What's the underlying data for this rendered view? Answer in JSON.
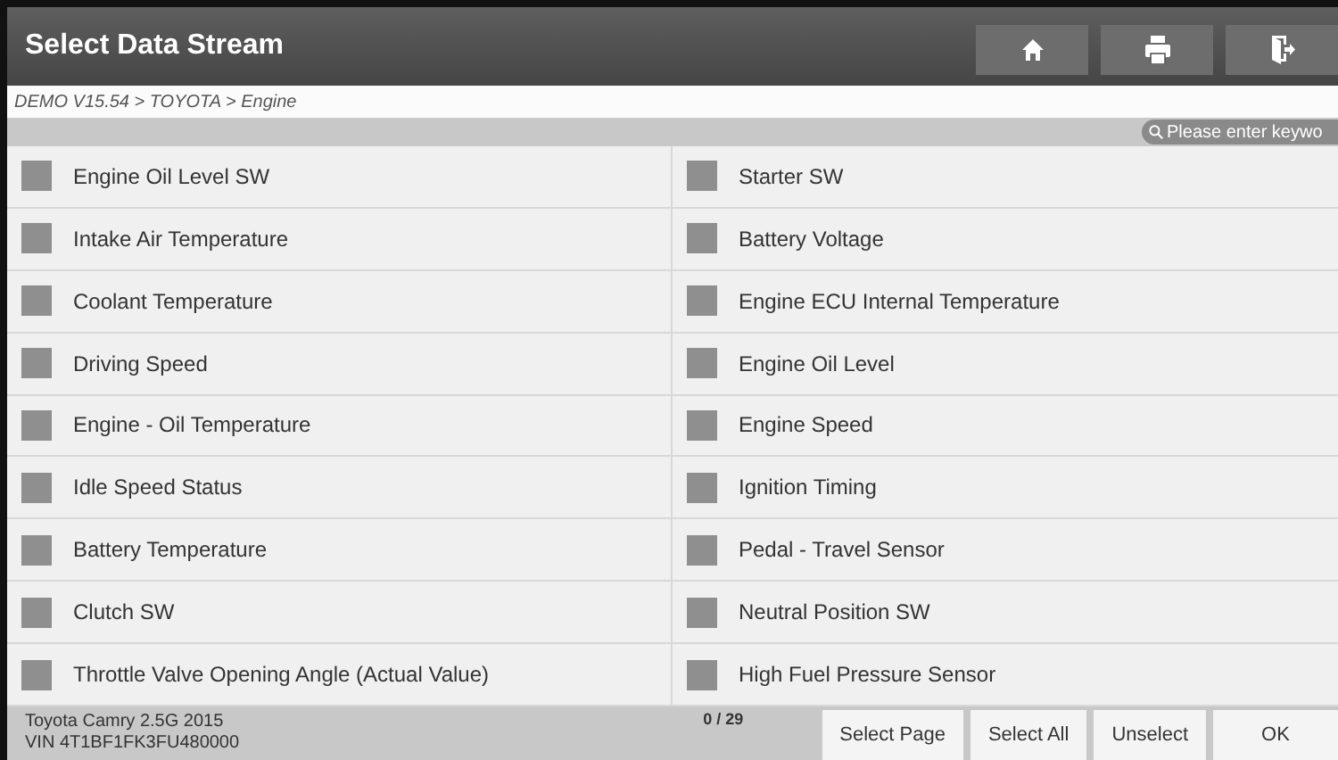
{
  "window": {
    "title": "Select Data Stream"
  },
  "breadcrumb": "DEMO V15.54 > TOYOTA > Engine",
  "search": {
    "placeholder": "Please enter keywo"
  },
  "items": [
    {
      "label": "Engine Oil Level SW",
      "checked": false
    },
    {
      "label": "Starter SW",
      "checked": false
    },
    {
      "label": "Intake Air Temperature",
      "checked": false
    },
    {
      "label": "Battery Voltage",
      "checked": false
    },
    {
      "label": "Coolant Temperature",
      "checked": false
    },
    {
      "label": "Engine ECU Internal Temperature",
      "checked": false
    },
    {
      "label": "Driving Speed",
      "checked": false
    },
    {
      "label": "Engine Oil Level",
      "checked": false
    },
    {
      "label": "Engine - Oil Temperature",
      "checked": false
    },
    {
      "label": "Engine Speed",
      "checked": false
    },
    {
      "label": "Idle Speed Status",
      "checked": false
    },
    {
      "label": "Ignition Timing",
      "checked": false
    },
    {
      "label": "Battery Temperature",
      "checked": false
    },
    {
      "label": "Pedal - Travel Sensor",
      "checked": false
    },
    {
      "label": "Clutch SW",
      "checked": false
    },
    {
      "label": "Neutral Position SW",
      "checked": false
    },
    {
      "label": "Throttle Valve Opening Angle (Actual Value)",
      "checked": false
    },
    {
      "label": "High Fuel Pressure Sensor",
      "checked": false
    }
  ],
  "counter": "0 / 29",
  "vehicle": {
    "model": "Toyota Camry 2.5G 2015",
    "vin": "VIN 4T1BF1FK3FU480000"
  },
  "buttons": [
    "Select Page",
    "Select All",
    "Unselect",
    "OK"
  ]
}
